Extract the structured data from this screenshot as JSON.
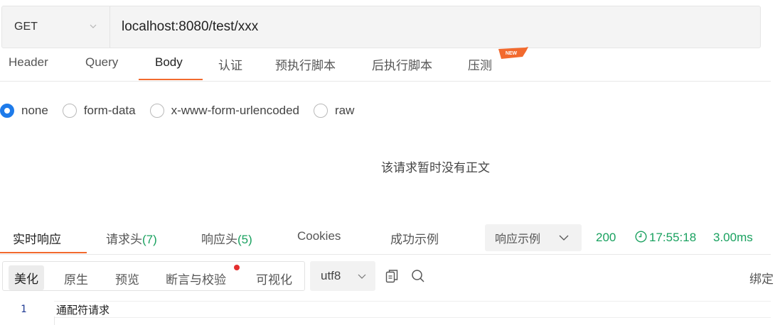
{
  "request": {
    "method": "GET",
    "url": "localhost:8080/test/xxx"
  },
  "request_tabs": {
    "header": "Header",
    "query": "Query",
    "body": "Body",
    "auth": "认证",
    "pre_script": "预执行脚本",
    "post_script": "后执行脚本",
    "stress": "压测",
    "new_badge": "NEW"
  },
  "body_types": {
    "none": "none",
    "form_data": "form-data",
    "urlencoded": "x-www-form-urlencoded",
    "raw": "raw",
    "selected": "none"
  },
  "body_empty_message": "该请求暂时没有正文",
  "response_tabs": {
    "realtime": "实时响应",
    "req_headers_label": "请求头",
    "req_headers_count": "(7)",
    "resp_headers_label": "响应头",
    "resp_headers_count": "(5)",
    "cookies": "Cookies",
    "success_example": "成功示例",
    "response_example": "响应示例"
  },
  "response_meta": {
    "status": "200",
    "time": "17:55:18",
    "duration": "3.00ms"
  },
  "format_toolbar": {
    "pretty": "美化",
    "raw": "原生",
    "preview": "预览",
    "assertion": "断言与校验",
    "visualize": "可视化",
    "encoding": "utf8",
    "bind": "绑定"
  },
  "code": {
    "lines": [
      {
        "no": "1",
        "text": "通配符请求"
      }
    ]
  },
  "colors": {
    "accent": "#f26a2e",
    "radio_selected": "#1e7bea",
    "success": "#19a15f",
    "badge_red": "#e42f2f"
  },
  "icons": {
    "method_dropdown": "chevron-down-icon",
    "response_example_dropdown": "chevron-down-icon",
    "clock": "clock-icon",
    "encoding_dropdown": "chevron-down-icon",
    "copy": "copy-icon",
    "search": "search-icon"
  }
}
